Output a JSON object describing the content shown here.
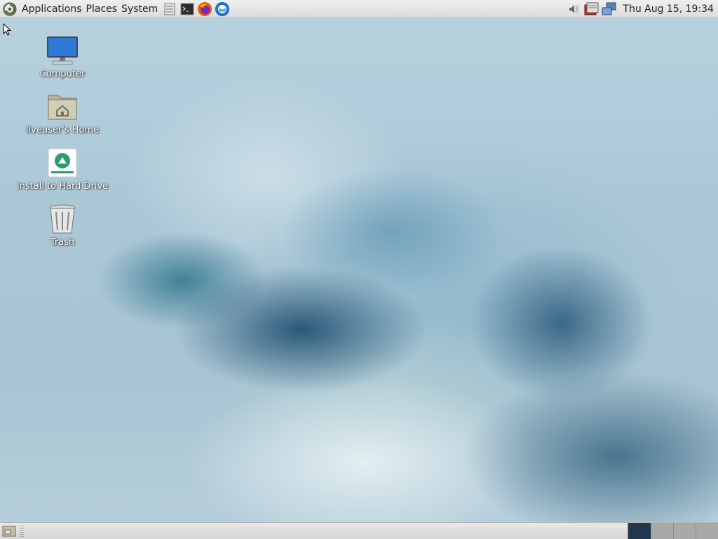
{
  "top_panel": {
    "menus": [
      {
        "label": "Applications"
      },
      {
        "label": "Places"
      },
      {
        "label": "System"
      }
    ],
    "launchers": [
      {
        "icon": "file-manager-icon"
      },
      {
        "icon": "terminal-icon"
      },
      {
        "icon": "firefox-icon"
      },
      {
        "icon": "thunderbird-icon"
      }
    ],
    "tray": [
      {
        "icon": "volume-icon"
      },
      {
        "icon": "update-notifier-icon"
      },
      {
        "icon": "network-icon"
      }
    ],
    "clock": "Thu Aug 15, 19:34"
  },
  "desktop": {
    "icons": [
      {
        "label": "Computer",
        "icon": "computer-icon"
      },
      {
        "label": "liveuser's Home",
        "icon": "home-folder-icon"
      },
      {
        "label": "Install to Hard Drive",
        "icon": "installer-icon"
      },
      {
        "label": "Trash",
        "icon": "trash-icon"
      }
    ]
  },
  "bottom_panel": {
    "workspaces": [
      {
        "active": true
      },
      {
        "active": false
      },
      {
        "active": false
      },
      {
        "active": false
      }
    ]
  },
  "colors": {
    "panel_bg": "#dcdcdc",
    "active_workspace": "#23364f",
    "installer_accent": "#2a9d6f"
  }
}
